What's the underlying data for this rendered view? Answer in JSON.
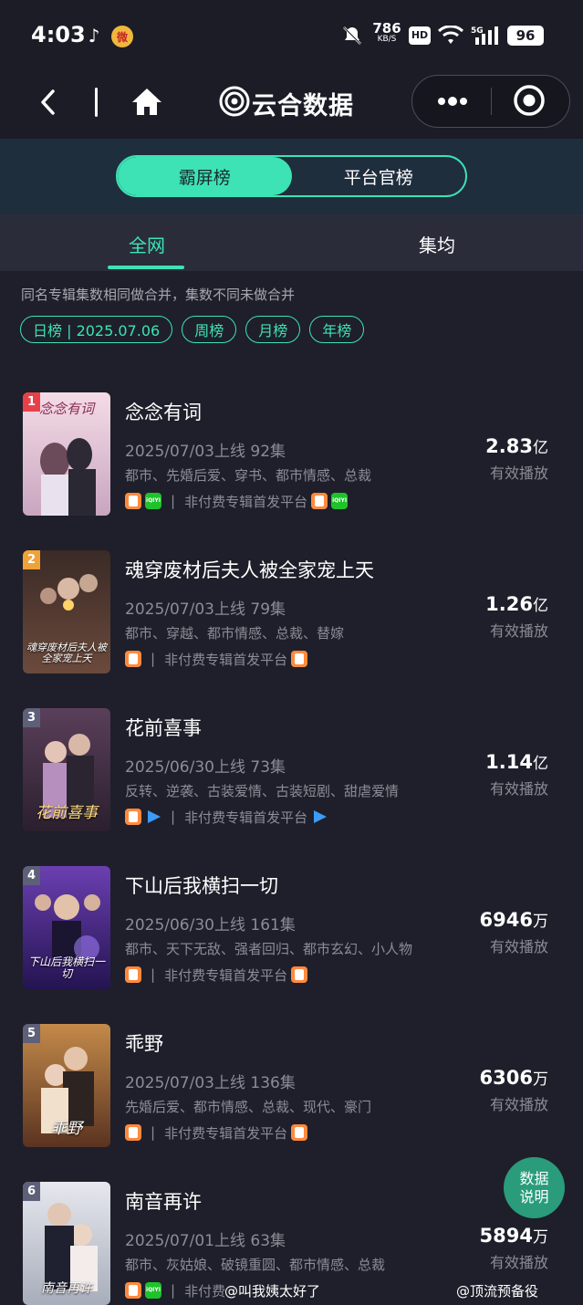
{
  "status_bar": {
    "time": "4:03",
    "net_speed": "786",
    "net_unit": "KB/S",
    "hd": "HD",
    "signal": "5G",
    "battery": "96"
  },
  "nav": {
    "title": "云合数据"
  },
  "segments": [
    {
      "label": "霸屏榜",
      "active": true
    },
    {
      "label": "平台官榜",
      "active": false
    }
  ],
  "tabs": {
    "all": "全网",
    "avg": "集均"
  },
  "notice": "同名专辑集数相同做合并，集数不同未做合并",
  "filters": [
    "日榜 | 2025.07.06",
    "周榜",
    "月榜",
    "年榜"
  ],
  "items": [
    {
      "rank": "1",
      "title": "念念有词",
      "meta": "2025/07/03上线 92集",
      "tags": "都市、先婚后爱、穿书、都市情感、总裁",
      "platform_text": "非付费专辑首发平台",
      "value": "2.83",
      "unit": "亿",
      "label": "有效播放",
      "poster_text": "念念有词",
      "rank_color": "#e8404a"
    },
    {
      "rank": "2",
      "title": "魂穿废材后夫人被全家宠上天",
      "meta": "2025/07/03上线 79集",
      "tags": "都市、穿越、都市情感、总裁、替嫁",
      "platform_text": "非付费专辑首发平台",
      "value": "1.26",
      "unit": "亿",
      "label": "有效播放",
      "poster_text": "魂穿废材后夫人被全家宠上天",
      "rank_color": "#f0a23a"
    },
    {
      "rank": "3",
      "title": "花前喜事",
      "meta": "2025/06/30上线 73集",
      "tags": "反转、逆袭、古装爱情、古装短剧、甜虐爱情",
      "platform_text": "非付费专辑首发平台",
      "value": "1.14",
      "unit": "亿",
      "label": "有效播放",
      "poster_text": "花前喜事",
      "rank_color": "#5d6078"
    },
    {
      "rank": "4",
      "title": "下山后我横扫一切",
      "meta": "2025/06/30上线 161集",
      "tags": "都市、天下无敌、强者回归、都市玄幻、小人物",
      "platform_text": "非付费专辑首发平台",
      "value": "6946",
      "unit": "万",
      "label": "有效播放",
      "poster_text": "下山后我横扫一切",
      "rank_color": "#5d6078"
    },
    {
      "rank": "5",
      "title": "乖野",
      "meta": "2025/07/03上线 136集",
      "tags": "先婚后爱、都市情感、总裁、现代、豪门",
      "platform_text": "非付费专辑首发平台",
      "value": "6306",
      "unit": "万",
      "label": "有效播放",
      "poster_text": "乖野",
      "rank_color": "#5d6078"
    },
    {
      "rank": "6",
      "title": "南音再许",
      "meta": "2025/07/01上线 63集",
      "tags": "都市、灰姑娘、破镜重圆、都市情感、总裁",
      "platform_text": "非付费",
      "value": "5894",
      "unit": "万",
      "label": "有效播放",
      "poster_text": "南音再许",
      "rank_color": "#5d6078"
    }
  ],
  "fab": {
    "line1": "数据",
    "line2": "说明"
  },
  "watermark": {
    "left": "@叫我姨太好了",
    "right": "@顶流预备役"
  }
}
